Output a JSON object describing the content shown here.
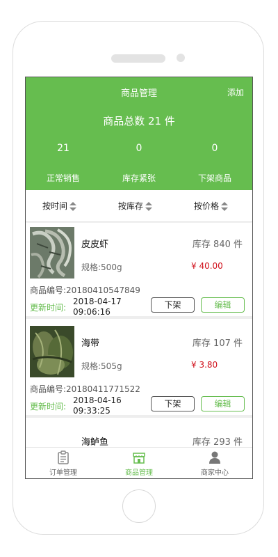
{
  "header": {
    "title": "商品管理",
    "add_label": "添加",
    "total_text": "商品总数 21 件"
  },
  "stats": [
    {
      "value": "21",
      "label": "正常销售"
    },
    {
      "value": "0",
      "label": "库存紧张"
    },
    {
      "value": "0",
      "label": "下架商品"
    }
  ],
  "sort": [
    {
      "label": "按时间"
    },
    {
      "label": "按库存"
    },
    {
      "label": "按价格"
    }
  ],
  "items": [
    {
      "name": "皮皮虾",
      "stock": "库存 840 件",
      "spec": "规格:500g",
      "price": "¥ 40.00",
      "code": "商品编号:20180410547849",
      "update_label": "更新时间:",
      "update_date": "2018-04-17",
      "update_time": "09:06:16",
      "off_label": "下架",
      "edit_label": "编辑"
    },
    {
      "name": "海带",
      "stock": "库存 107 件",
      "spec": "规格:505g",
      "price": "¥ 3.80",
      "code": "商品编号:20180411771522",
      "update_label": "更新时间:",
      "update_date": "2018-04-16",
      "update_time": "09:33:25",
      "off_label": "下架",
      "edit_label": "编辑"
    },
    {
      "name": "海鲈鱼",
      "stock": "库存 293 件"
    }
  ],
  "tabs": [
    {
      "label": "订单管理",
      "icon": "clipboard-icon"
    },
    {
      "label": "商品管理",
      "icon": "shop-icon"
    },
    {
      "label": "商家中心",
      "icon": "user-icon"
    }
  ],
  "colors": {
    "accent": "#66bd4f",
    "price": "#d0101b"
  }
}
